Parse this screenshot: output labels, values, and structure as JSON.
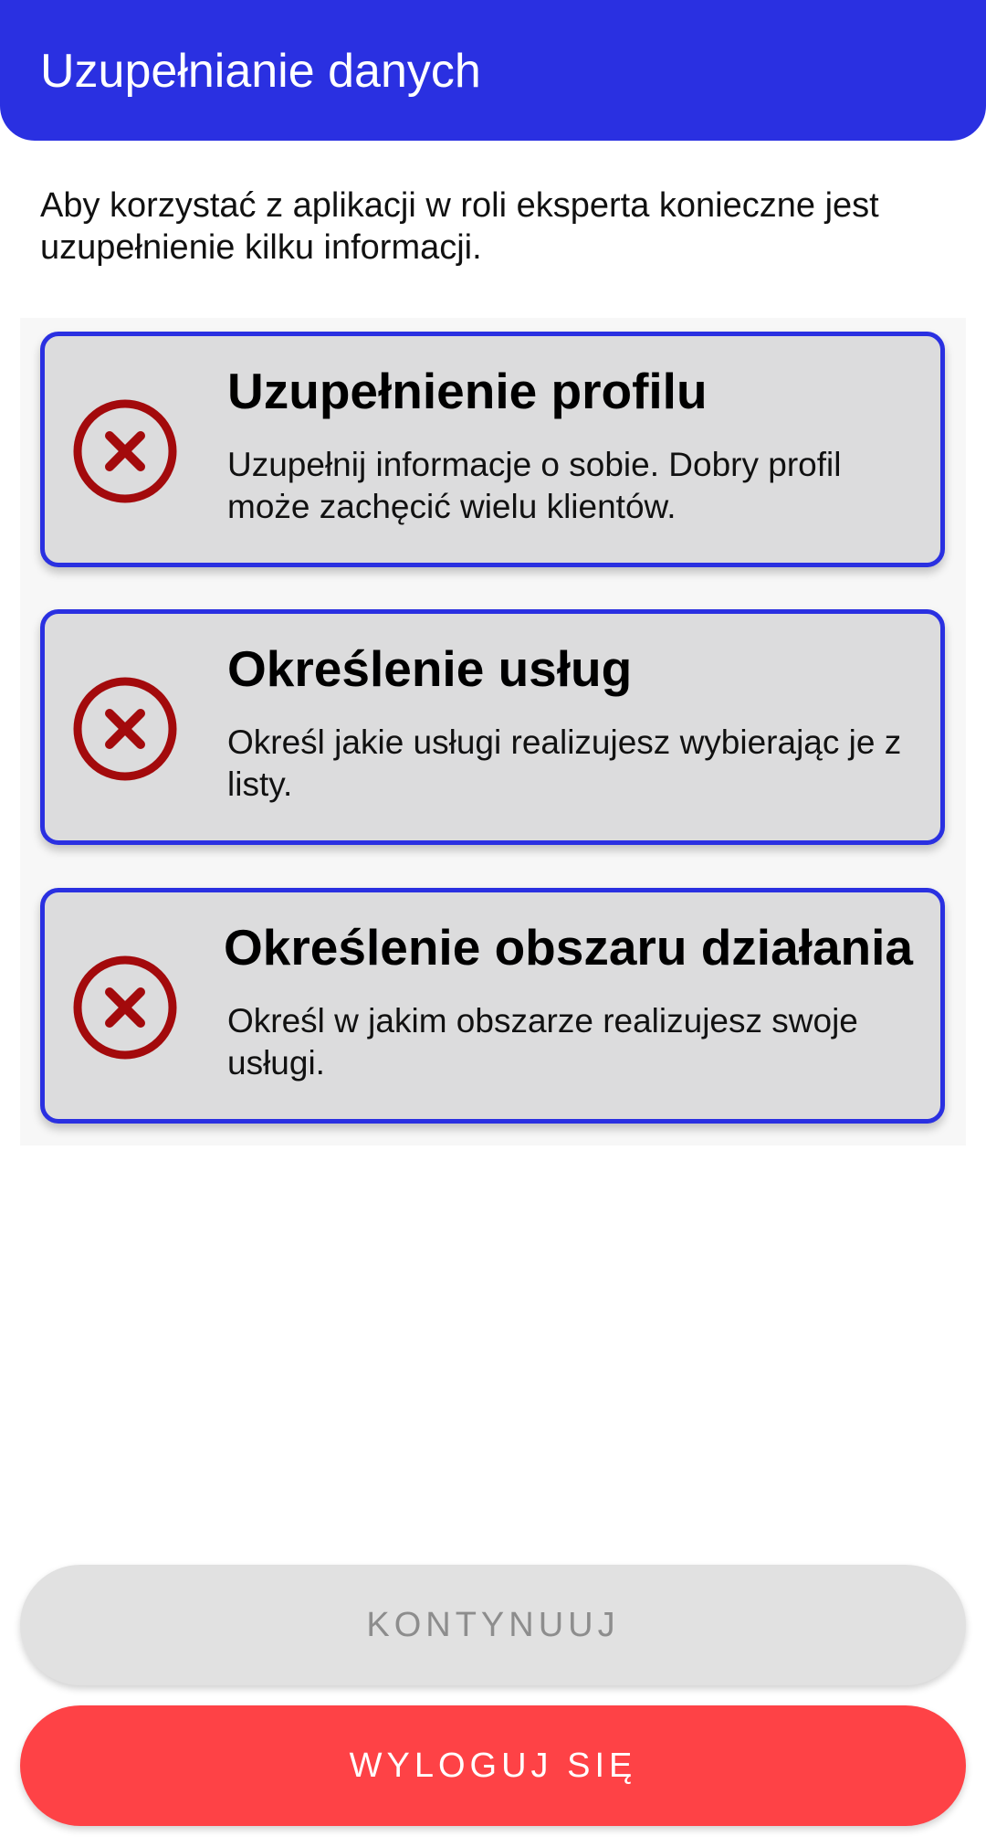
{
  "header": {
    "title": "Uzupełnianie danych"
  },
  "intro_text": "Aby korzystać z aplikacji w roli eksperta konieczne jest uzupełnienie kilku informacji.",
  "tasks": [
    {
      "title": "Uzupełnienie profilu",
      "description": "Uzupełnij informacje o sobie. Dobry profil może zachęcić wielu klientów.",
      "status": "incomplete",
      "icon": "error-circle-x-icon"
    },
    {
      "title": "Określenie usług",
      "description": "Określ jakie usługi realizujesz wybierając je z listy.",
      "status": "incomplete",
      "icon": "error-circle-x-icon"
    },
    {
      "title": "Określenie obszaru działania",
      "description": "Określ w jakim obszarze realizujesz swoje usługi.",
      "status": "incomplete",
      "icon": "error-circle-x-icon"
    }
  ],
  "buttons": {
    "continue_label": "KONTYNUUJ",
    "continue_enabled": false,
    "logout_label": "WYLOGUJ SIĘ"
  },
  "colors": {
    "primary": "#2a30e1",
    "error": "#a30a0c",
    "logout": "#fe4246",
    "card_background": "#dcdcdd",
    "disabled_button": "#e1e1e1"
  }
}
